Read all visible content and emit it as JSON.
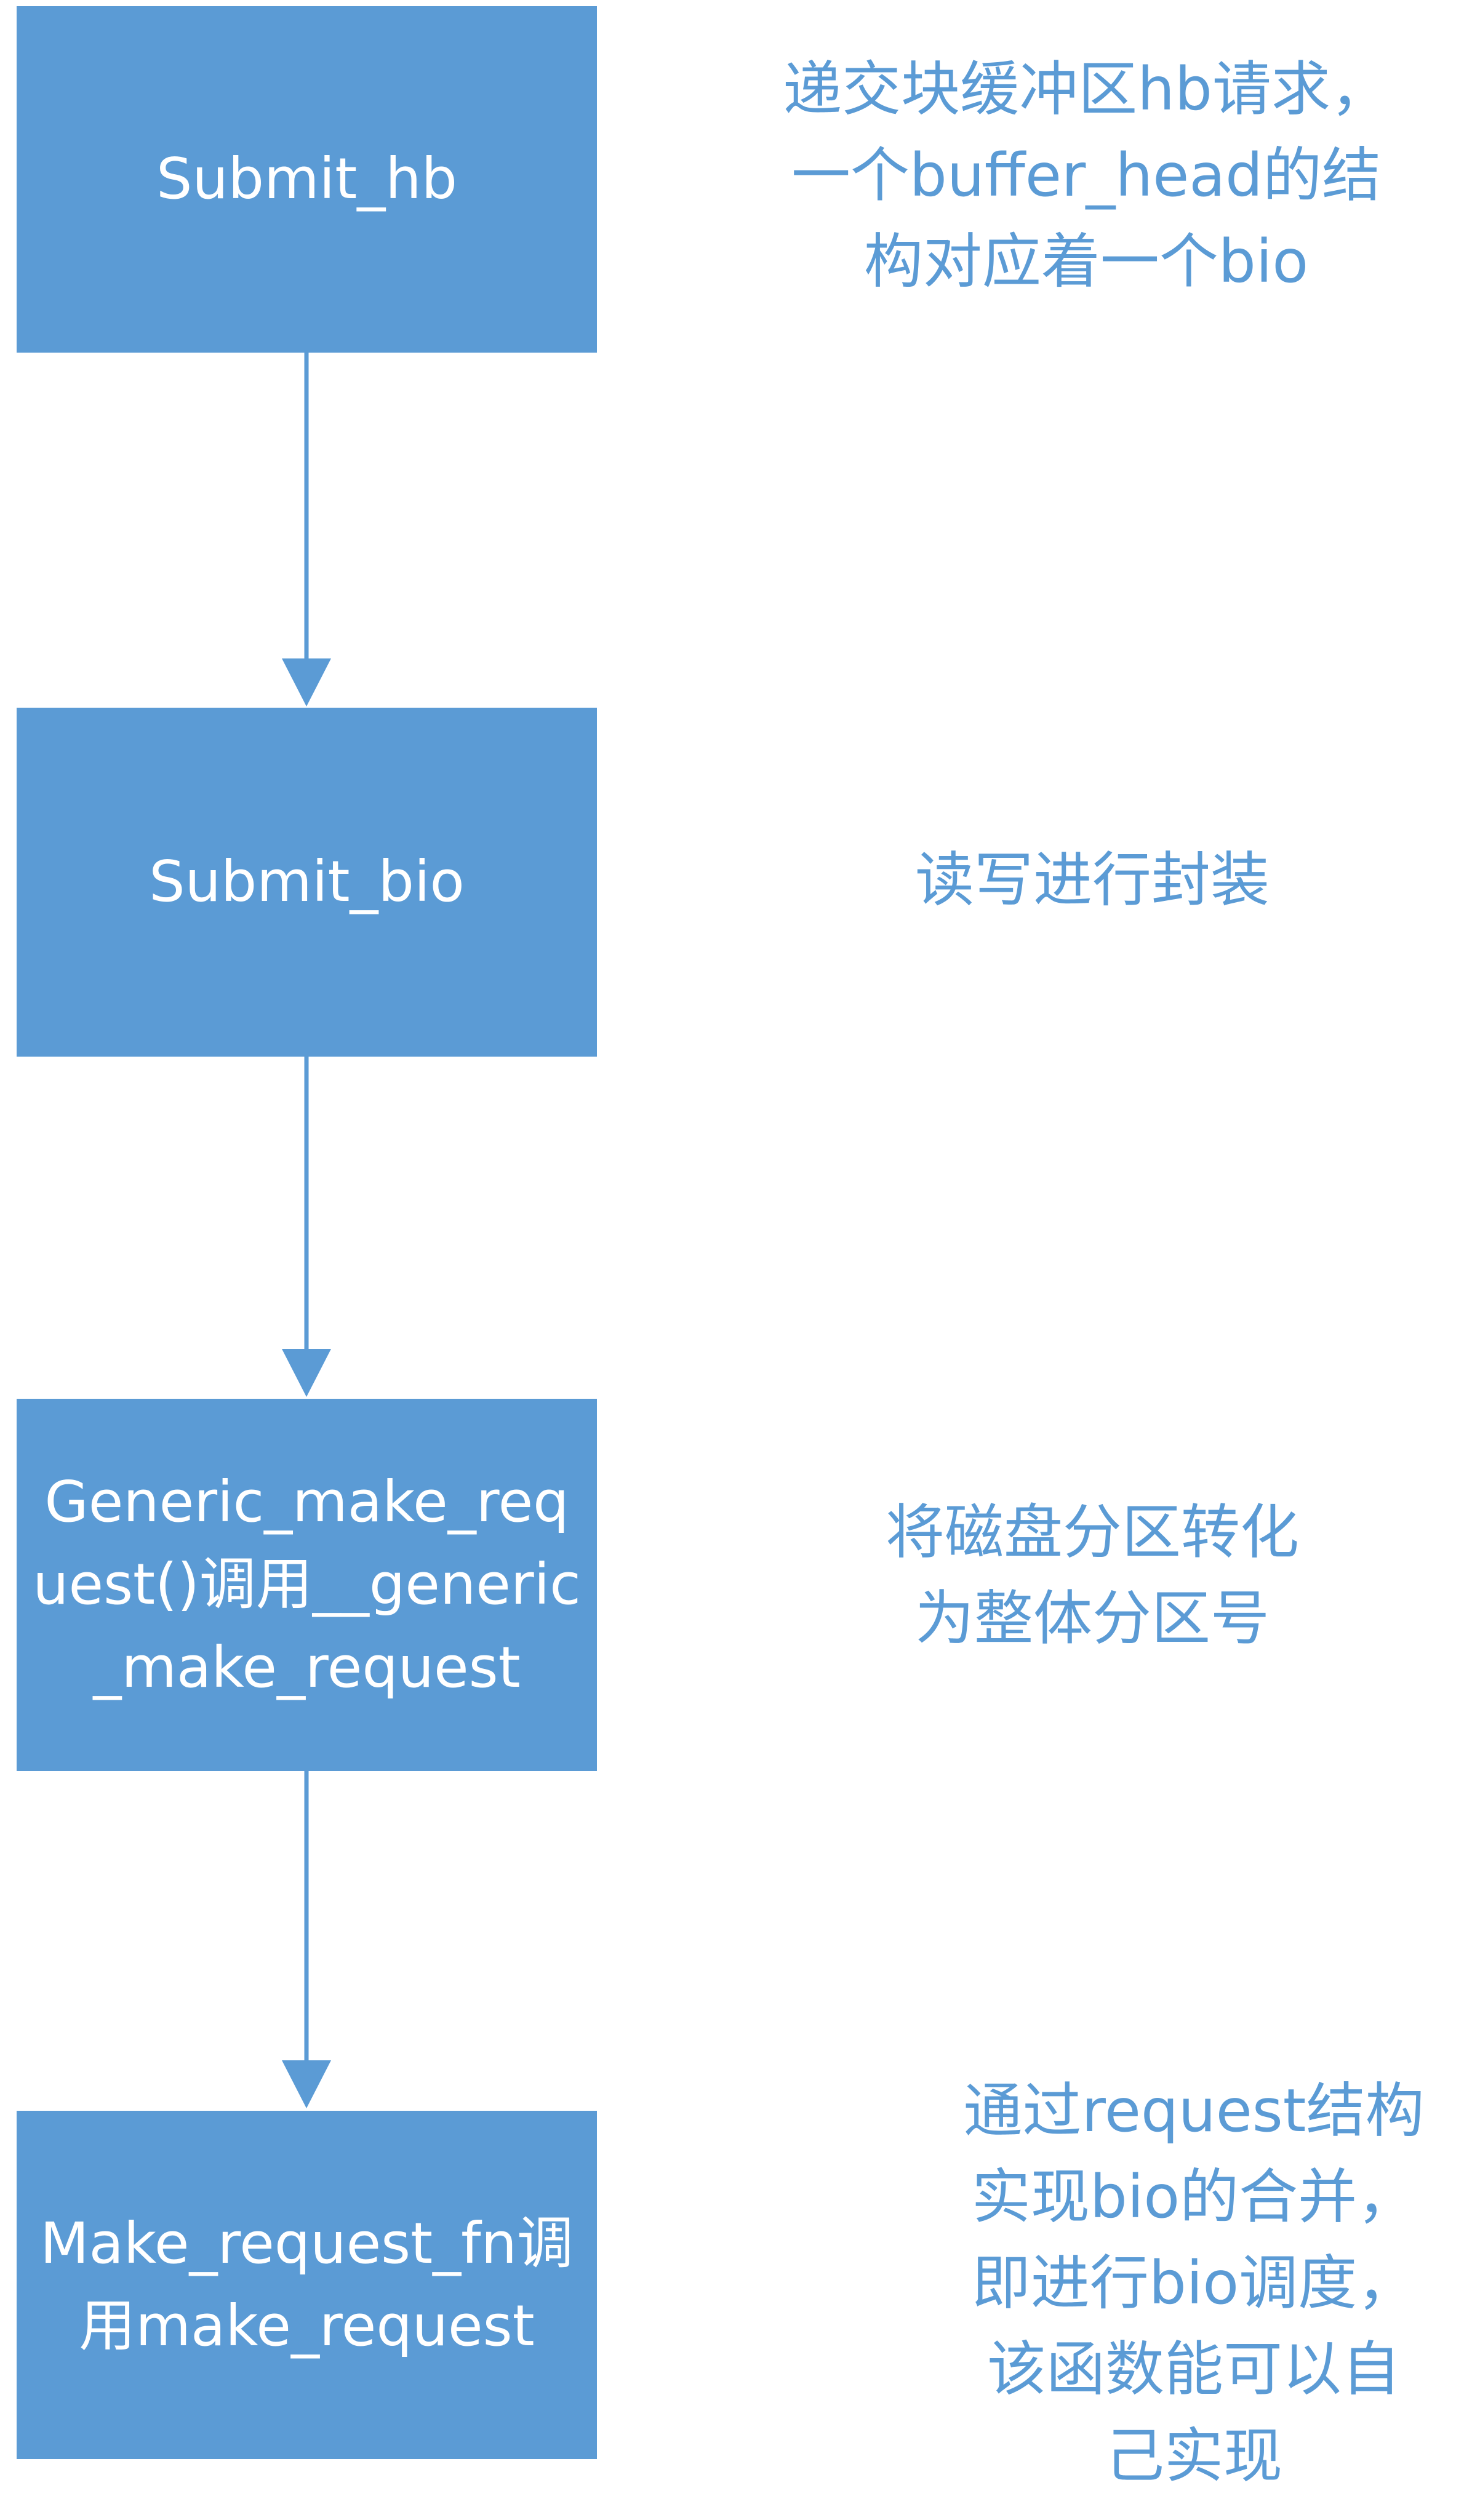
{
  "steps": [
    {
      "label": "Submit_hb",
      "note": "递交块缓冲区hb请求，\n一个buffer_head的结\n构对应着一个bio"
    },
    {
      "label": "Submit_bio",
      "note": "读写进行封装"
    },
    {
      "label": "Generic_make_request()调用__generic_make_request",
      "note": "将磁盘分区转化\n为整体分区号"
    },
    {
      "label": "Make_request_fn调用make_request",
      "note": "通过request结构\n实现bio的合并，\n即进行bio调度，\n该函数能可以自\n己实现"
    }
  ],
  "colors": {
    "box_fill": "#5b9bd5",
    "box_text": "#ffffff",
    "note_text": "#5b9bd5",
    "arrow": "#5b9bd5"
  }
}
